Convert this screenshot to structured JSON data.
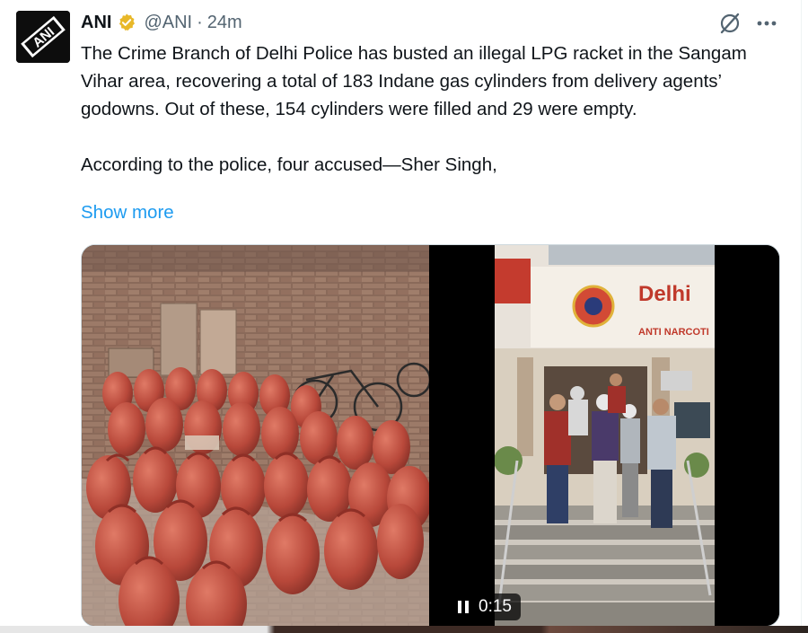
{
  "tweet": {
    "author_name": "ANI",
    "handle": "@ANI",
    "separator": "·",
    "time": "24m",
    "text": "The Crime Branch of Delhi Police has busted an illegal LPG racket in the Sangam Vihar area, recovering a total of 183 Indane gas cylinders from delivery agents’ godowns. Out of these, 154 cylinders were filled and 29 were empty.\n\nAccording to the police, four accused—Sher Singh,",
    "show_more": "Show more"
  },
  "media": {
    "sign_delhi": "Delhi",
    "sign_anti": "ANTI NARCOTI",
    "video_time": "0:15"
  },
  "colors": {
    "link": "#1d9bf0",
    "verified": "#e8b829",
    "muted": "#536471"
  },
  "icons": {
    "avatar": "ani-logo",
    "verified": "verified-badge-icon",
    "grok": "grok-icon",
    "more": "more-icon",
    "pause": "pause-icon"
  }
}
